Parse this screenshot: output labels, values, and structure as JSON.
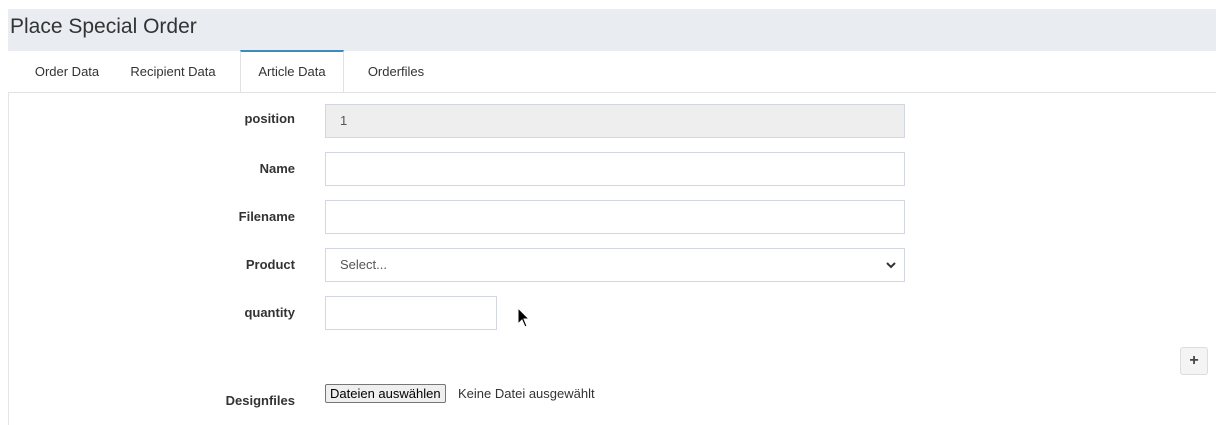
{
  "header": {
    "title": "Place Special Order"
  },
  "tabs": [
    {
      "label": "Order Data",
      "active": false
    },
    {
      "label": "Recipient Data",
      "active": false
    },
    {
      "label": "Article Data",
      "active": true
    },
    {
      "label": "Orderfiles",
      "active": false
    }
  ],
  "form": {
    "position": {
      "label": "position",
      "value": "1"
    },
    "name": {
      "label": "Name",
      "value": ""
    },
    "filename": {
      "label": "Filename",
      "value": ""
    },
    "product": {
      "label": "Product",
      "selected": "Select..."
    },
    "quantity": {
      "label": "quantity",
      "value": ""
    },
    "designfiles": {
      "label": "Designfiles",
      "button_label": "Dateien auswählen",
      "status": "Keine Datei ausgewählt"
    }
  },
  "add_button": {
    "label": "+"
  },
  "colors": {
    "header_bg": "#e9edf2",
    "active_tab_border": "#3c8dbc",
    "readonly_bg": "#eeeeee"
  },
  "icons": {
    "select_caret": "chevron-down-icon",
    "pointer": "mouse-cursor-icon"
  }
}
